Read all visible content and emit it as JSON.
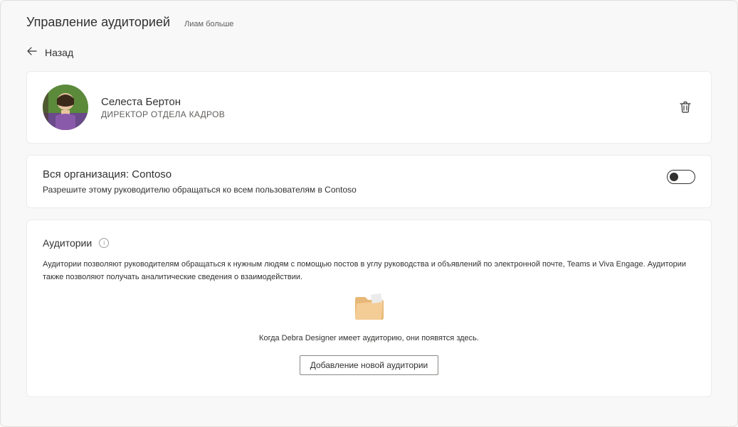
{
  "header": {
    "title": "Управление аудиторией",
    "subtitle": "Лиам больше"
  },
  "back": {
    "label": "Назад"
  },
  "profile": {
    "name": "Селеста Бертон",
    "role": "ДИРЕКТОР ОТДЕЛА КАДРОВ"
  },
  "org": {
    "title": "Вся организация: Contoso",
    "description": "Разрешите этому руководителю обращаться ко всем пользователям в Contoso",
    "toggle": false
  },
  "audiences": {
    "title": "Аудитории",
    "description": "Аудитории позволяют руководителям обращаться к нужным людям с помощью постов в углу руководства и объявлений по электронной почте, Teams и Viva Engage. Аудитории также позволяют получать аналитические сведения о взаимодействии.",
    "empty_text": "Когда Debra Designer имеет аудиторию, они появятся здесь.",
    "add_button": "Добавление новой аудитории"
  }
}
